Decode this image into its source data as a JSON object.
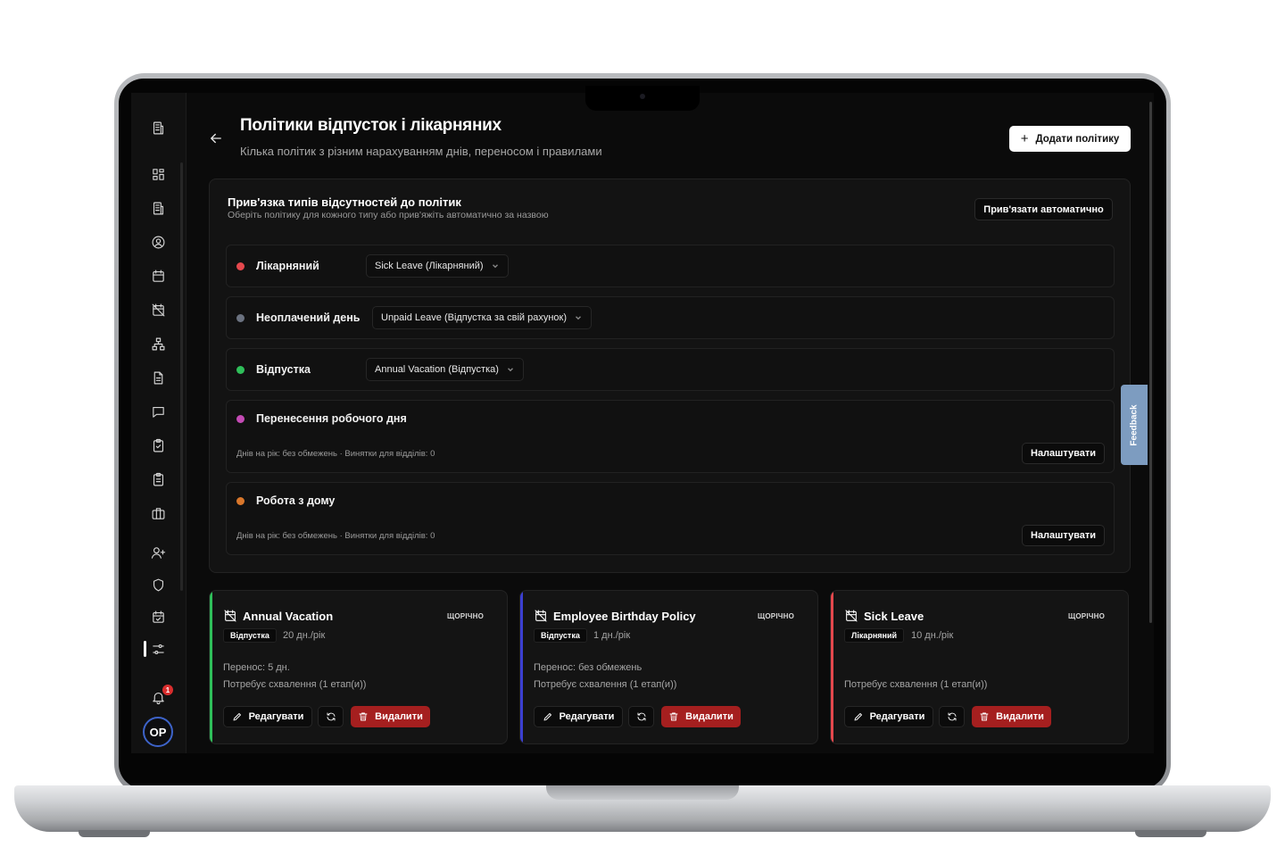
{
  "header": {
    "title": "Політики відпусток і лікарняних",
    "subtitle": "Кілька політик з різним нарахуванням днів, переносом і правилами",
    "add_button": "Додати політику"
  },
  "binding": {
    "title": "Прив'язка типів відсутностей до політик",
    "subtitle": "Оберіть політику для кожного типу або прив'яжіть автоматично за назвою",
    "auto_button": "Прив'язати автоматично",
    "rows": [
      {
        "label": "Лікарняний",
        "color": "#e5484d",
        "select": "Sick Leave (Лікарняний)"
      },
      {
        "label": "Неоплачений день",
        "color": "#6b7280",
        "select": "Unpaid Leave (Відпустка за свій рахунок)"
      },
      {
        "label": "Відпустка",
        "color": "#2fbf5a",
        "select": "Annual Vacation (Відпустка)"
      },
      {
        "label": "Перенесення робочого дня",
        "color": "#c44bb5",
        "meta": "Днів на рік: без обмежень · Винятки для відділів: 0",
        "button": "Налаштувати"
      },
      {
        "label": "Робота з дому",
        "color": "#d9772b",
        "meta": "Днів на рік: без обмежень · Винятки для відділів: 0",
        "button": "Налаштувати"
      }
    ]
  },
  "cards": [
    {
      "title": "Annual Vacation",
      "period": "ЩОРІЧНО",
      "tag": "Відпустка",
      "days": "20 дн./рік",
      "lines": [
        "Перенос: 5 дн.",
        "Потребує схвалення (1 етап(и))"
      ],
      "accent": "#2fbf5a",
      "edit": "Редагувати",
      "delete": "Видалити"
    },
    {
      "title": "Employee Birthday Policy",
      "period": "ЩОРІЧНО",
      "tag": "Відпустка",
      "days": "1 дн./рік",
      "lines": [
        "Перенос: без обмежень",
        "Потребує схвалення (1 етап(и))"
      ],
      "accent": "#3b3fd1",
      "edit": "Редагувати",
      "delete": "Видалити"
    },
    {
      "title": "Sick Leave",
      "period": "ЩОРІЧНО",
      "tag": "Лікарняний",
      "days": "10 дн./рік",
      "lines": [
        "Потребує схвалення (1 етап(и))"
      ],
      "accent": "#e5484d",
      "edit": "Редагувати",
      "delete": "Видалити"
    }
  ],
  "sidebar": {
    "icons": [
      "building-icon",
      "dashboard-icon",
      "company-icon",
      "profile-icon",
      "calendar-icon",
      "calendar-off-icon",
      "org-chart-icon",
      "document-icon",
      "chat-icon",
      "clipboard-check-icon",
      "clipboard-list-icon",
      "briefcase-icon",
      "user-plus-icon",
      "shield-icon",
      "calendar-check-icon",
      "settings-sliders-icon",
      "bell-icon"
    ],
    "notification_count": "1",
    "avatar_initials": "OP"
  },
  "feedback_label": "Feedback"
}
